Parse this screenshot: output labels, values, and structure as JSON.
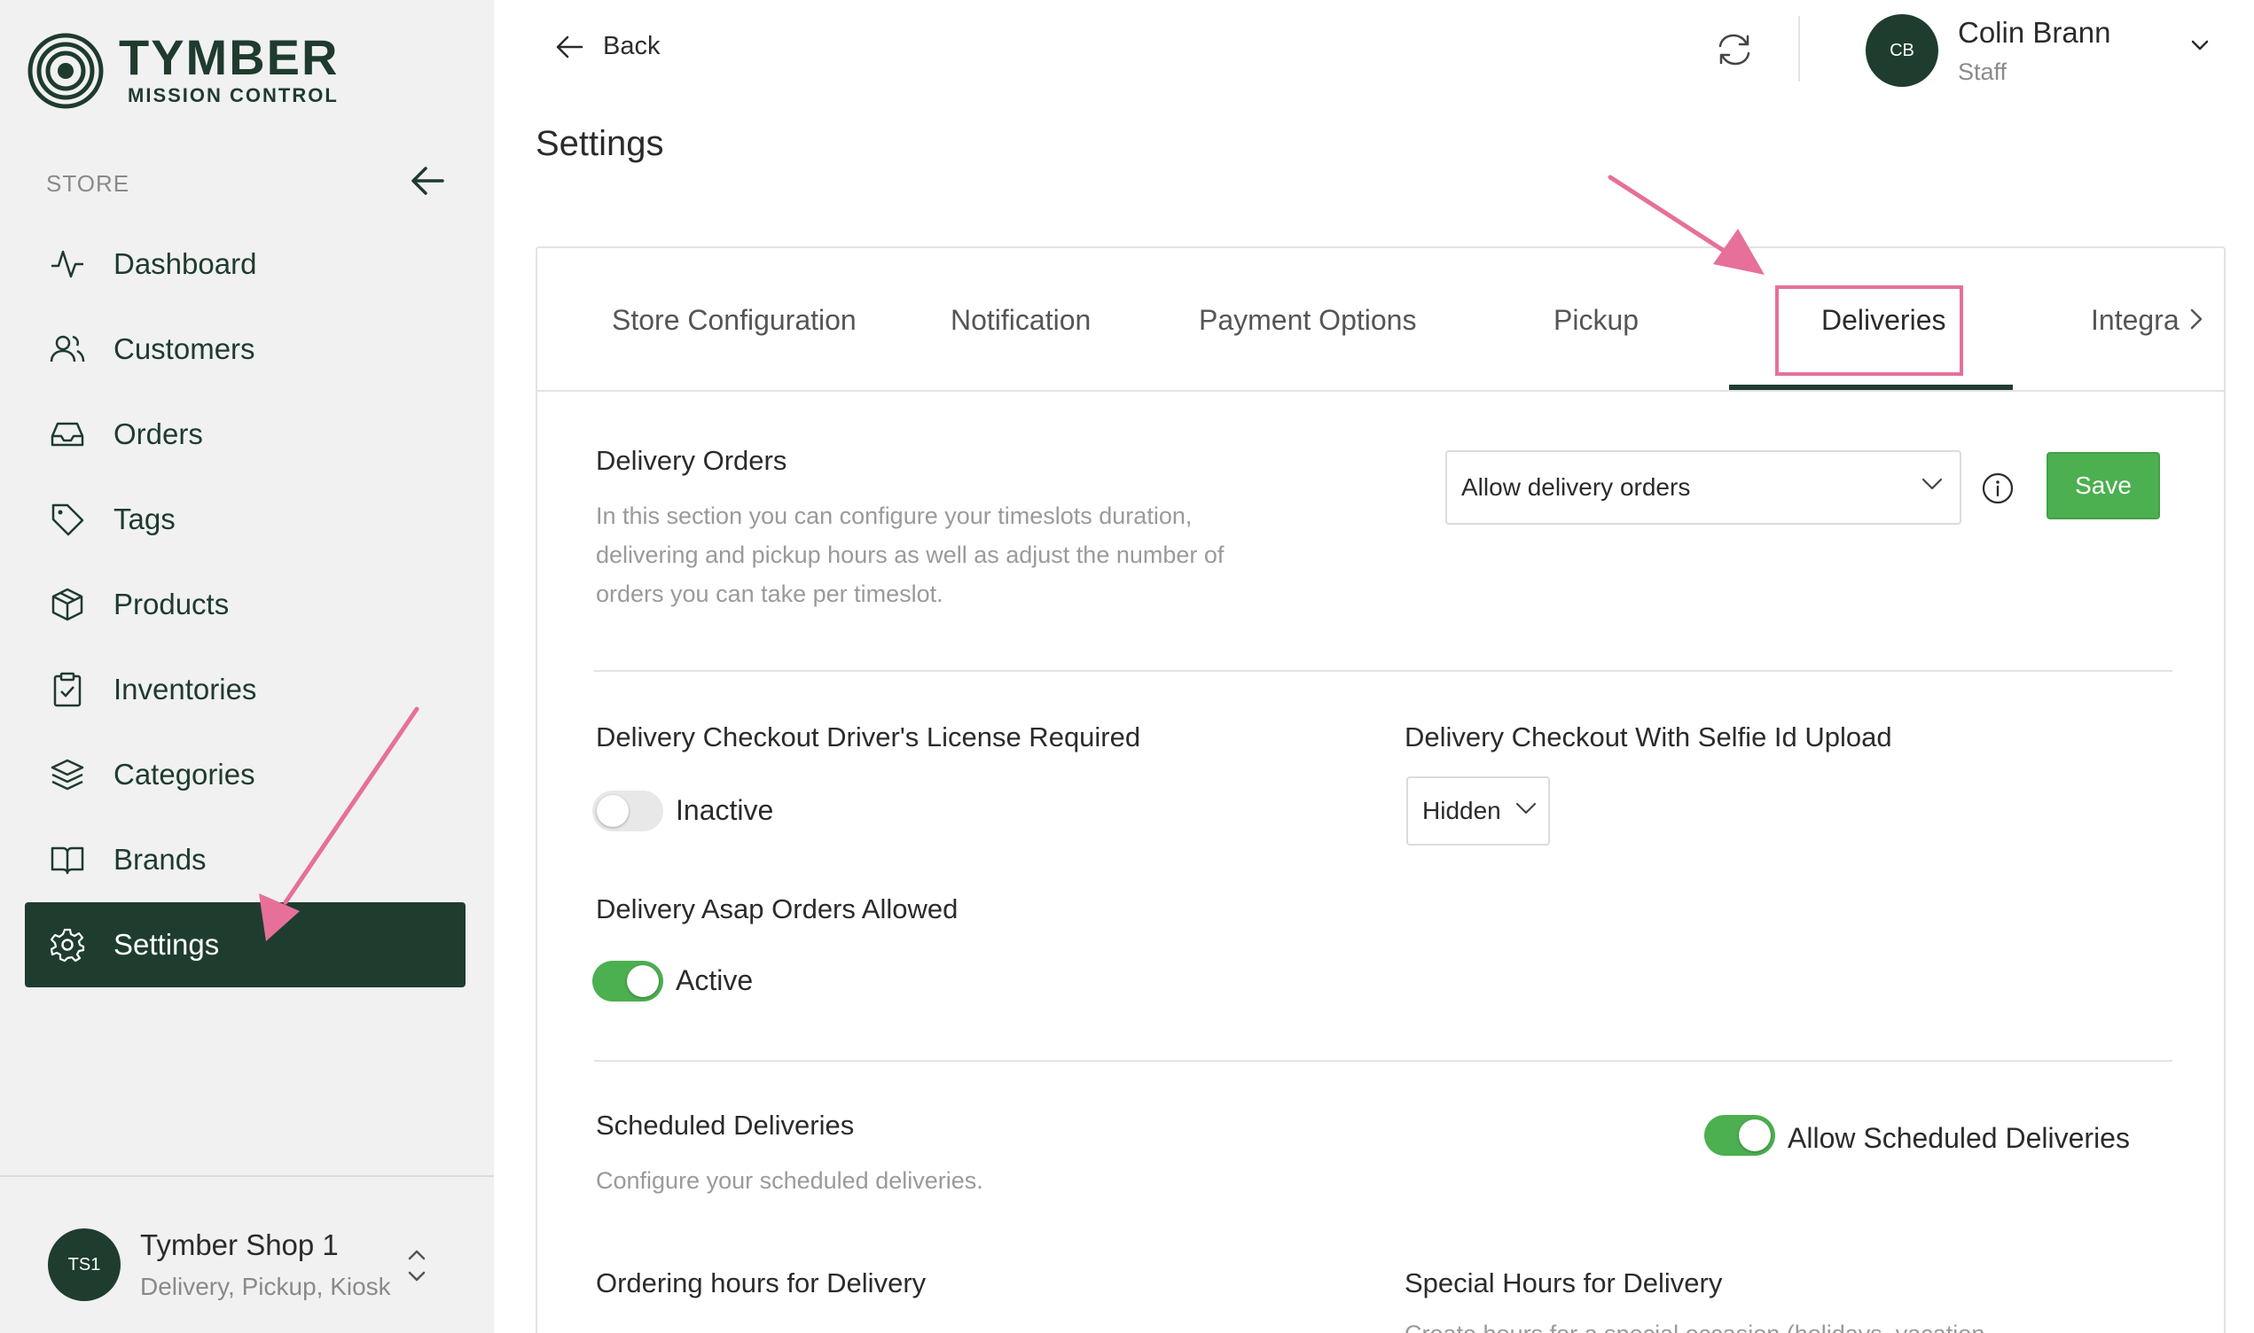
{
  "brand": {
    "title": "TYMBER",
    "subtitle": "MISSION CONTROL"
  },
  "sidebar": {
    "section_label": "STORE",
    "items": [
      {
        "label": "Dashboard",
        "icon": "activity-icon"
      },
      {
        "label": "Customers",
        "icon": "users-icon"
      },
      {
        "label": "Orders",
        "icon": "inbox-icon"
      },
      {
        "label": "Tags",
        "icon": "tag-icon"
      },
      {
        "label": "Products",
        "icon": "box-icon"
      },
      {
        "label": "Inventories",
        "icon": "clipboard-icon"
      },
      {
        "label": "Categories",
        "icon": "layers-icon"
      },
      {
        "label": "Brands",
        "icon": "book-icon"
      },
      {
        "label": "Settings",
        "icon": "gear-icon",
        "active": true
      }
    ],
    "store": {
      "initials": "TS1",
      "name": "Tymber Shop 1",
      "types": "Delivery, Pickup, Kiosk"
    }
  },
  "topbar": {
    "back_label": "Back",
    "user": {
      "initials": "CB",
      "name": "Colin Brann",
      "role": "Staff"
    }
  },
  "page": {
    "title": "Settings"
  },
  "tabs": [
    {
      "label": "Store Configuration"
    },
    {
      "label": "Notification"
    },
    {
      "label": "Payment Options"
    },
    {
      "label": "Pickup"
    },
    {
      "label": "Deliveries",
      "active": true
    },
    {
      "label": "Integra"
    }
  ],
  "delivery_orders": {
    "title": "Delivery Orders",
    "description_lines": [
      "In this section you can configure your timeslots duration,",
      "delivering and pickup hours as well as adjust the number of",
      "orders you can take per timeslot."
    ],
    "select_value": "Allow delivery orders",
    "save_label": "Save"
  },
  "license_required": {
    "title": "Delivery Checkout Driver's License Required",
    "state_label": "Inactive",
    "enabled": false
  },
  "selfie_upload": {
    "title": "Delivery Checkout With Selfie Id Upload",
    "select_value": "Hidden"
  },
  "asap_orders": {
    "title": "Delivery Asap Orders Allowed",
    "state_label": "Active",
    "enabled": true
  },
  "scheduled": {
    "title": "Scheduled Deliveries",
    "description": "Configure your scheduled deliveries.",
    "toggle_label": "Allow Scheduled Deliveries",
    "enabled": true
  },
  "ordering_hours": {
    "title": "Ordering hours for Delivery"
  },
  "special_hours": {
    "title": "Special Hours for Delivery",
    "description_partial": "Create hours for a special occasion (holidays, vacation"
  },
  "colors": {
    "brand_green": "#1f3d2f",
    "accent_green": "#4caf50",
    "annotation_pink": "#e6709a"
  }
}
